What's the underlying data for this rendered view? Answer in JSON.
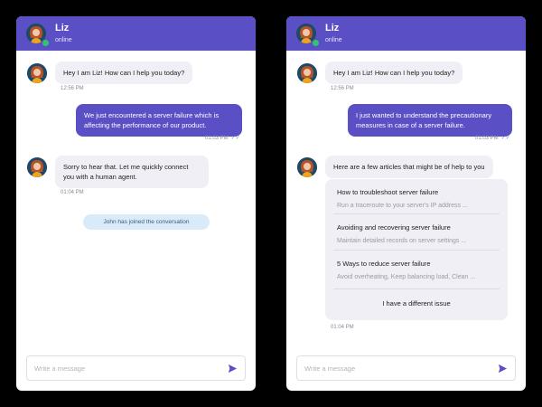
{
  "agent": {
    "name": "Liz",
    "status": "online"
  },
  "input": {
    "placeholder": "Write a message"
  },
  "colors": {
    "accent": "#5a4fc5",
    "online": "#33c46b",
    "user_bubble": "#5a4fc5",
    "bot_bubble": "#f0eff6",
    "join_badge": "#d9ebf9"
  },
  "icons": {
    "avatar": "agent-avatar",
    "send": "send-icon",
    "read_receipt": "double-check-icon"
  },
  "chat1": {
    "msg1": {
      "text": "Hey I am Liz! How can I help you today?",
      "time": "12:56 PM"
    },
    "msg2": {
      "text": "We just encountered a server failure which is affecting the performance of our product.",
      "time": "01:03 PM"
    },
    "msg3": {
      "text": "Sorry to hear that. Let me quickly connect you with a human agent.",
      "time": "01:04 PM"
    },
    "system": "John has joined the conversation"
  },
  "chat2": {
    "msg1": {
      "text": "Hey I am Liz! How can I help you today?",
      "time": "12:56 PM"
    },
    "msg2": {
      "text": "I just wanted to understand the precautionary measures in case of a server failure.",
      "time": "01:03 PM"
    },
    "msg3": {
      "text": "Here are a few articles that might be of help to you"
    },
    "articles": [
      {
        "title": "How to troubleshoot server failure",
        "desc": "Run a traceroute to your server's IP address ..."
      },
      {
        "title": "Avoiding and recovering server failure",
        "desc": "Maintain detailed records on server settings ..."
      },
      {
        "title": "5 Ways to reduce server failure",
        "desc": "Avoid overheating, Keep balancing load, Clean ..."
      }
    ],
    "other_option": "I have a different issue",
    "cards_time": "01:04 PM"
  }
}
